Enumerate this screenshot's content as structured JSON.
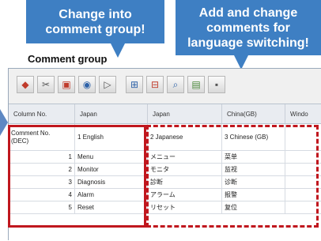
{
  "callouts": {
    "change_group": "Change into\ncomment group!",
    "add_change": "Add and change\ncomments for\nlanguage switching!"
  },
  "group_label": "Comment group",
  "toolbar": {
    "icons": [
      "open-icon",
      "cut-icon",
      "copy-icon",
      "refresh-icon",
      "paste-icon",
      "add-column-icon",
      "delete-column-icon",
      "search-icon",
      "export-icon",
      "more-icon"
    ]
  },
  "grid": {
    "headers": [
      "Column No.",
      "Japan",
      "Japan",
      "China(GB)",
      "Windo"
    ],
    "comment_row": {
      "label": "Comment No.\n(DEC)",
      "col1": "1 English",
      "col2": "2 Japanese",
      "col3": "3 Chinese (GB)"
    },
    "rows": [
      {
        "no": "1",
        "english": "Menu",
        "japanese": "メニュー",
        "chinese": "菜单"
      },
      {
        "no": "2",
        "english": "Monitor",
        "japanese": "モニタ",
        "chinese": "监视"
      },
      {
        "no": "3",
        "english": "Diagnosis",
        "japanese": "診断",
        "chinese": "诊断"
      },
      {
        "no": "4",
        "english": "Alarm",
        "japanese": "アラーム",
        "chinese": "报警"
      },
      {
        "no": "5",
        "english": "Reset",
        "japanese": "リセット",
        "chinese": "复位"
      }
    ]
  },
  "colors": {
    "callout": "#3e7fc3",
    "highlight": "#c0171e",
    "arrow": "#5e88c3"
  }
}
